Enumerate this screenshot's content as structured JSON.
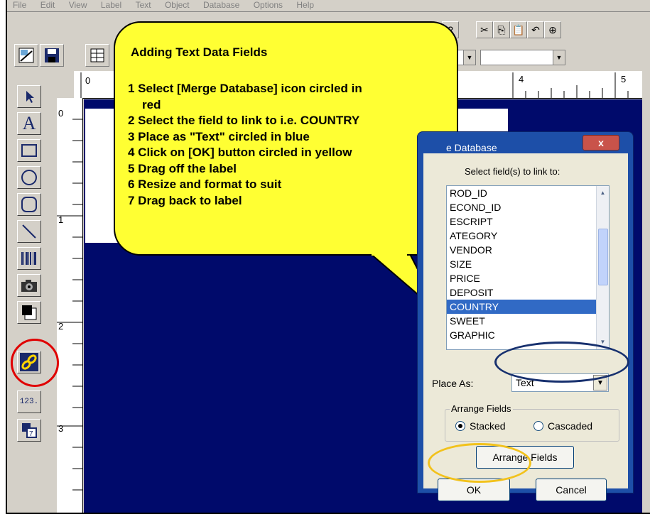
{
  "menu": [
    "File",
    "Edit",
    "View",
    "Label",
    "Text",
    "Object",
    "Database",
    "Options",
    "Help"
  ],
  "ruler": {
    "top_marks": [
      "0",
      "4",
      "5"
    ],
    "left_marks": [
      "0",
      "1",
      "2",
      "3"
    ]
  },
  "tools": [
    {
      "icon": "arrow-pointer-icon"
    },
    {
      "icon": "text-tool-icon",
      "label": "A"
    },
    {
      "icon": "rectangle-icon"
    },
    {
      "icon": "ellipse-icon"
    },
    {
      "icon": "rounded-rectangle-icon"
    },
    {
      "icon": "line-icon"
    },
    {
      "icon": "barcode-icon"
    },
    {
      "icon": "camera-icon"
    },
    {
      "icon": "color-fill-icon"
    },
    {
      "icon": "merge-database-icon"
    },
    {
      "icon": "counter-icon",
      "label": "123."
    },
    {
      "icon": "sequence-icon"
    }
  ],
  "callout": {
    "title": "Adding Text Data Fields",
    "steps": [
      "1 Select [Merge Database] icon circled in",
      "red",
      "2 Select the field to link to i.e. COUNTRY",
      "3 Place as \"Text\" circled in blue",
      "4 Click on [OK] button circled in yellow",
      "5 Drag off the label",
      "6 Resize and format to suit",
      "7 Drag back to label"
    ]
  },
  "dialog": {
    "title": "e Database",
    "close_label": "x",
    "prompt": "Select field(s) to link to:",
    "fields": [
      "ROD_ID",
      "ECOND_ID",
      "ESCRIPT",
      "ATEGORY",
      "VENDOR",
      "SIZE",
      "PRICE",
      "DEPOSIT",
      "COUNTRY",
      "SWEET",
      "GRAPHIC"
    ],
    "selected_field": "COUNTRY",
    "place_as_label": "Place As:",
    "place_as_value": "Text",
    "arrange_group_label": "Arrange Fields",
    "radio_stacked": "Stacked",
    "radio_cascaded": "Cascaded",
    "arrange_button": "Arrange Fields",
    "ok_button": "OK",
    "cancel_button": "Cancel"
  },
  "colors": {
    "canvas": "#000a6b",
    "callout": "#ffff33",
    "highlight_red": "#e00000",
    "highlight_blue": "#17306e",
    "highlight_yellow": "#f2c21c",
    "selection": "#316ac5"
  }
}
